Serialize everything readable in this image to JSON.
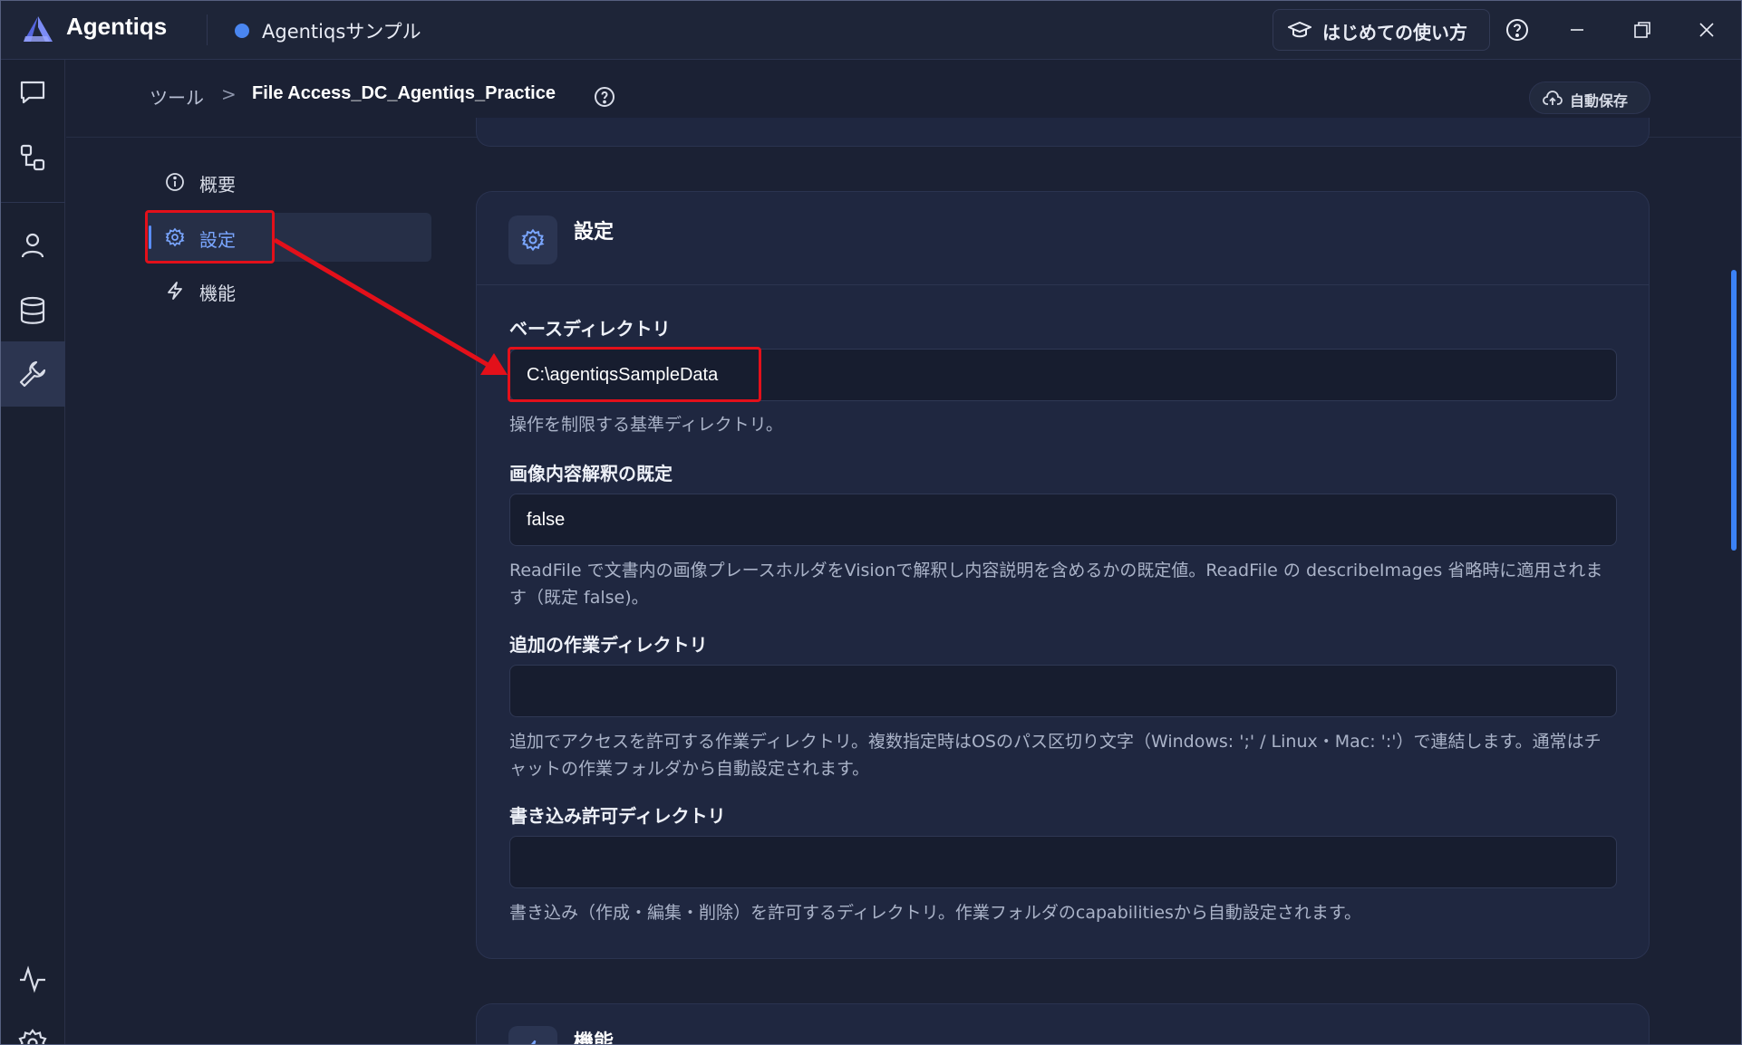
{
  "app": {
    "name": "Agentiqs",
    "workspace": "Agentiqsサンプル",
    "guide_label": "はじめての使い方"
  },
  "breadcrumb": {
    "root": "ツール",
    "separator": ">",
    "current": "File Access_DC_Agentiqs_Practice",
    "autosave": "自動保存"
  },
  "rail": {
    "items": [
      "chat-icon",
      "workflow-icon",
      "user-icon",
      "database-icon",
      "wrench-icon"
    ],
    "bottom": [
      "activity-icon",
      "settings-gear-icon"
    ],
    "active": "wrench-icon"
  },
  "section_nav": {
    "items": [
      {
        "label": "概要",
        "icon": "info-icon"
      },
      {
        "label": "設定",
        "icon": "gear-icon"
      },
      {
        "label": "機能",
        "icon": "lightning-icon"
      }
    ],
    "active": "設定"
  },
  "settings_card": {
    "title": "設定",
    "fields": [
      {
        "label": "ベースディレクトリ",
        "value": "C:\\agentiqsSampleData",
        "help": "操作を制限する基準ディレクトリ。"
      },
      {
        "label": "画像内容解釈の既定",
        "value": "false",
        "help": "ReadFile で文書内の画像プレースホルダをVisionで解釈し内容説明を含めるかの既定値。ReadFile の describeImages 省略時に適用されます（既定 false)。"
      },
      {
        "label": "追加の作業ディレクトリ",
        "value": "",
        "help": "追加でアクセスを許可する作業ディレクトリ。複数指定時はOSのパス区切り文字（Windows: ';' / Linux・Mac: ':'）で連結します。通常はチャットの作業フォルダから自動設定されます。"
      },
      {
        "label": "書き込み許可ディレクトリ",
        "value": "",
        "help": "書き込み（作成・編集・削除）を許可するディレクトリ。作業フォルダのcapabilitiesから自動設定されます。"
      }
    ]
  },
  "next_card": {
    "title": "機能"
  },
  "colors": {
    "background": "#1b2134",
    "card": "#1f2740",
    "accent": "#5a8cf5",
    "annotation": "#e3101a"
  }
}
